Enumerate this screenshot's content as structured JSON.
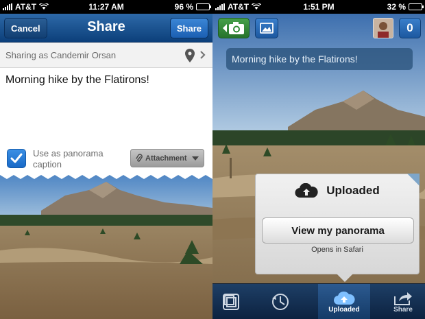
{
  "left": {
    "statusbar": {
      "carrier": "AT&T",
      "time": "11:27 AM",
      "battery": "96 %",
      "battery_level": 0.96
    },
    "navbar": {
      "title": "Share",
      "cancel_label": "Cancel",
      "share_label": "Share"
    },
    "sharing_as": "Sharing as Candemir Orsan",
    "message": "Morning hike by the Flatirons!",
    "caption_checkbox": {
      "checked": true,
      "label": "Use as panorama caption"
    },
    "attachment_label": "Attachment"
  },
  "right": {
    "statusbar": {
      "carrier": "AT&T",
      "time": "1:51 PM",
      "battery": "32 %",
      "battery_level": 0.32
    },
    "count": "0",
    "caption": "Morning hike by the Flatirons!",
    "popup": {
      "title": "Uploaded",
      "button_label": "View my panorama",
      "subtext": "Opens in Safari"
    },
    "tabs": [
      {
        "label": "",
        "icon": "gallery-copy-icon"
      },
      {
        "label": "",
        "icon": "rotate-icon"
      },
      {
        "label": "Uploaded",
        "icon": "cloud-icon",
        "active": true
      },
      {
        "label": "Share",
        "icon": "share-arrow-icon"
      }
    ]
  },
  "colors": {
    "nav_blue": "#1b5fb2",
    "check_blue": "#1869c7",
    "camera_green": "#2e8a33",
    "tabbar_navy": "#0c2240"
  }
}
